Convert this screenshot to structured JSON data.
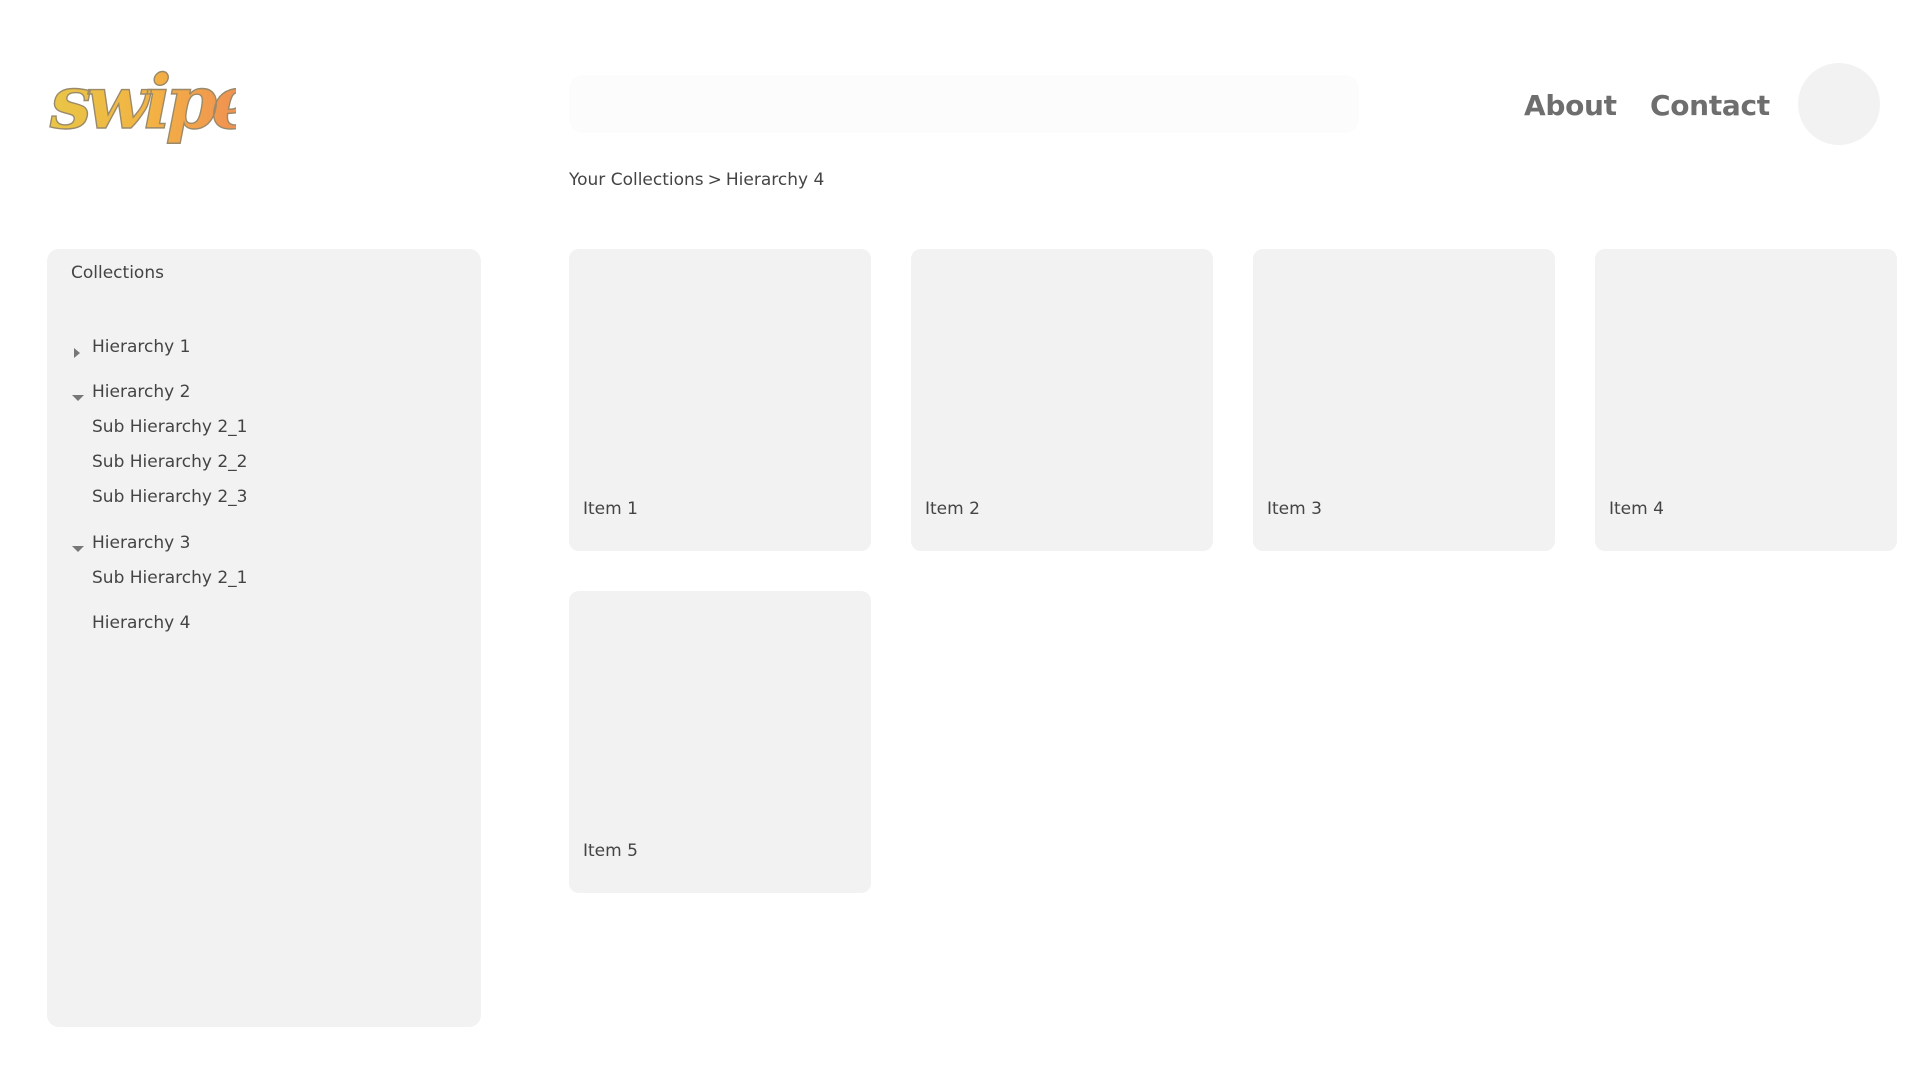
{
  "header": {
    "logo_text": "swipe",
    "search": {
      "value": "",
      "placeholder": ""
    },
    "nav": {
      "about_label": "About",
      "contact_label": "Contact"
    }
  },
  "breadcrumb": {
    "root": "Your Collections",
    "separator": ">",
    "current": "Hierarchy 4"
  },
  "sidebar": {
    "title": "Collections",
    "items": [
      {
        "label": "Hierarchy 1",
        "toggle": "collapsed",
        "level": 0
      },
      {
        "label": "Hierarchy 2",
        "toggle": "expanded",
        "level": 0
      },
      {
        "label": "Sub Hierarchy 2_1",
        "toggle": "none",
        "level": 1
      },
      {
        "label": "Sub Hierarchy 2_2",
        "toggle": "none",
        "level": 1
      },
      {
        "label": "Sub Hierarchy 2_3",
        "toggle": "none",
        "level": 1
      },
      {
        "label": "Hierarchy 3",
        "toggle": "expanded",
        "level": 0
      },
      {
        "label": "Sub Hierarchy 2_1",
        "toggle": "none",
        "level": 1
      },
      {
        "label": "Hierarchy 4",
        "toggle": "none",
        "level": 0
      }
    ]
  },
  "grid": {
    "items": [
      {
        "label": "Item 1"
      },
      {
        "label": "Item 2"
      },
      {
        "label": "Item 3"
      },
      {
        "label": "Item 4"
      },
      {
        "label": "Item 5"
      }
    ]
  },
  "colors": {
    "logo_gradient_start": "#e9c23a",
    "logo_gradient_end": "#f08a4b",
    "panel_bg": "#f2f2f2",
    "nav_text": "#6e6e6e",
    "body_text": "#444444"
  },
  "icons": {
    "collapsed": "caret-right-icon",
    "expanded": "caret-down-icon"
  }
}
